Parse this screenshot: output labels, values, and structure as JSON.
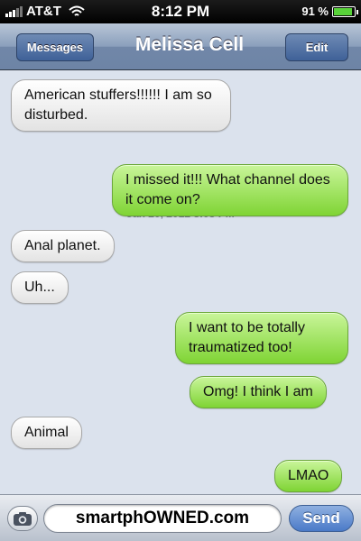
{
  "status_bar": {
    "carrier": "AT&T",
    "time": "8:12 PM",
    "battery_percent": "91 %",
    "battery_level": 0.91,
    "icons": [
      "signal-icon",
      "wifi-icon",
      "battery-icon"
    ]
  },
  "nav": {
    "back_label": "Messages",
    "title": "Melissa Cell",
    "edit_label": "Edit"
  },
  "thread": {
    "timestamp": "Jan 20, 2012 8:05 PM",
    "messages": [
      {
        "from": "them",
        "text": "American stuffers!!!!!!    I am so disturbed."
      },
      {
        "from": "me",
        "text": "I missed it!!! What channel does it come on?"
      },
      {
        "from": "them",
        "text": "Anal planet."
      },
      {
        "from": "them",
        "text": "Uh..."
      },
      {
        "from": "me",
        "text": "I want to be totally traumatized too!"
      },
      {
        "from": "me",
        "text": "Omg! I think I am"
      },
      {
        "from": "them",
        "text": "Animal"
      },
      {
        "from": "me",
        "text": "LMAO"
      }
    ]
  },
  "input": {
    "value": "smartphOWNED.com",
    "send_label": "Send",
    "camera_icon": "camera-icon"
  },
  "colors": {
    "incoming_bubble": "#f2f2f2",
    "outgoing_bubble": "#9be45a",
    "background": "#dbe2ed",
    "nav_bar": "#7187a8"
  }
}
